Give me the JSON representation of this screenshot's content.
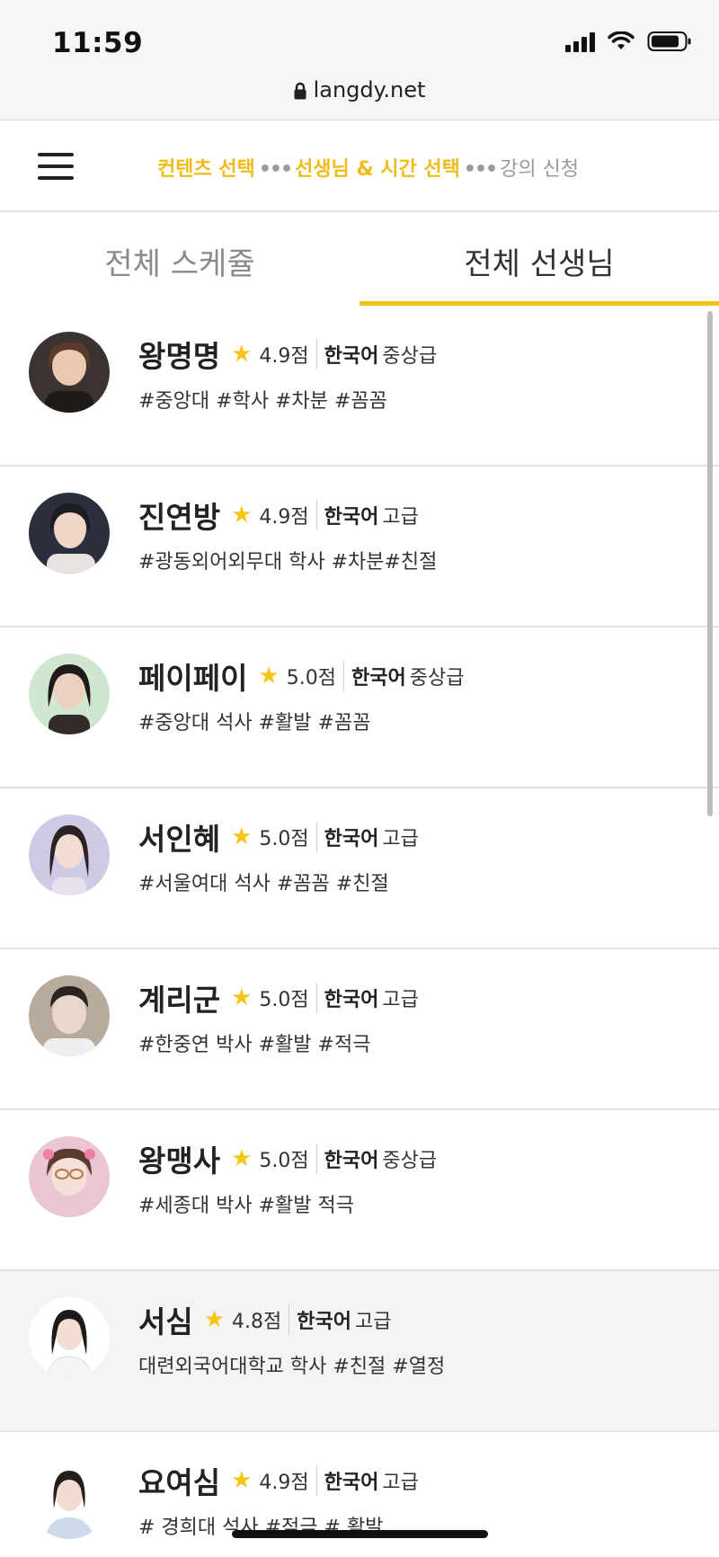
{
  "status_bar": {
    "time": "11:59"
  },
  "browser": {
    "url": "langdy.net"
  },
  "steps": {
    "step1": "컨텐츠 선택",
    "step2": "선생님 & 시간 선택",
    "step3": "강의 신청",
    "separator": "•••"
  },
  "tabs": [
    {
      "label": "전체 스케쥴"
    },
    {
      "label": "전체 선생님"
    }
  ],
  "colors": {
    "accent": "#f0c419",
    "star": "#f5c518",
    "row_highlight": "#f4f4f4"
  },
  "teachers": [
    {
      "name": "왕명명",
      "rating": "4.9점",
      "language": "한국어",
      "level": "중상급",
      "tags": "#중앙대 #학사 #차분 #꼼꼼",
      "avatar": "avatar-photo"
    },
    {
      "name": "진연방",
      "rating": "4.9점",
      "language": "한국어",
      "level": "고급",
      "tags": "#광동외어외무대 학사 #차분#친절",
      "avatar": "avatar-photo"
    },
    {
      "name": "페이페이",
      "rating": "5.0점",
      "language": "한국어",
      "level": "중상급",
      "tags": "#중앙대 석사 #활발 #꼼꼼",
      "avatar": "avatar-photo"
    },
    {
      "name": "서인혜",
      "rating": "5.0점",
      "language": "한국어",
      "level": "고급",
      "tags": "#서울여대 석사 #꼼꼼 #친절",
      "avatar": "avatar-photo"
    },
    {
      "name": "계리군",
      "rating": "5.0점",
      "language": "한국어",
      "level": "고급",
      "tags": "#한중연 박사 #활발 #적극",
      "avatar": "avatar-photo"
    },
    {
      "name": "왕맹사",
      "rating": "5.0점",
      "language": "한국어",
      "level": "중상급",
      "tags": "#세종대 박사 #활발 적극",
      "avatar": "avatar-photo"
    },
    {
      "name": "서심",
      "rating": "4.8점",
      "language": "한국어",
      "level": "고급",
      "tags": "대련외국어대학교 학사 #친절 #열정",
      "avatar": "avatar-photo"
    },
    {
      "name": "요여심",
      "rating": "4.9점",
      "language": "한국어",
      "level": "고급",
      "tags": "# 경희대 석사 #적극 # 활발",
      "avatar": "avatar-photo"
    }
  ]
}
